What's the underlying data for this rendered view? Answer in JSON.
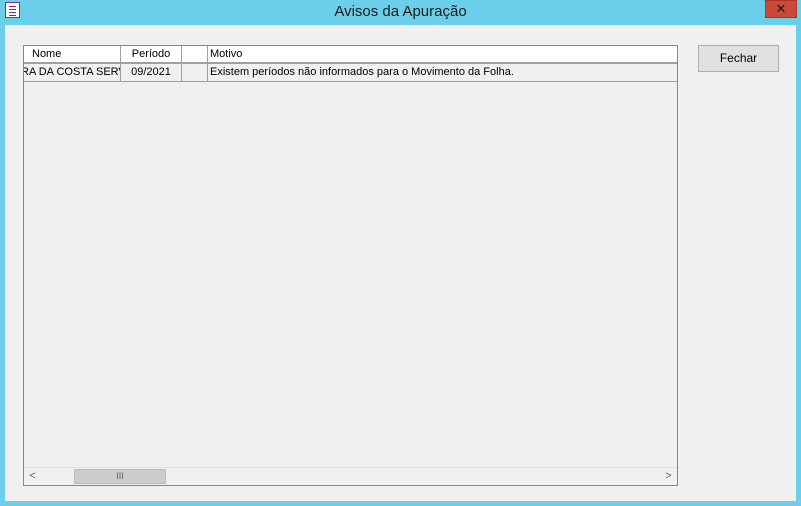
{
  "window": {
    "title": "Avisos da Apuração",
    "close_label": "✕"
  },
  "grid": {
    "columns": [
      "Nome",
      "Período",
      "",
      "Motivo"
    ],
    "rows": [
      {
        "nome": "RA DA COSTA SERV",
        "periodo": "09/2021",
        "blank": "",
        "motivo": "Existem períodos não informados para o Movimento da Folha."
      }
    ],
    "scroll_left": "<",
    "scroll_right": ">",
    "scroll_thumb": "III"
  },
  "buttons": {
    "fechar": "Fechar"
  }
}
